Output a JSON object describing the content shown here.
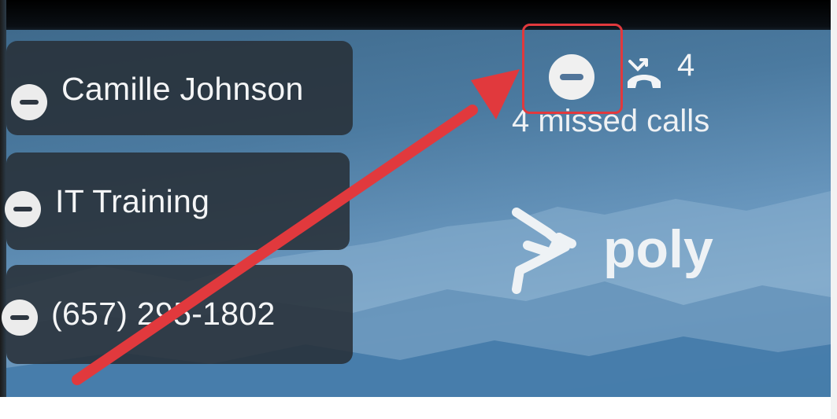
{
  "header": {
    "status_icon": "do-not-disturb-icon",
    "missed_calls_icon": "missed-call-icon",
    "missed_calls_count": "4",
    "missed_calls_text": "4 missed calls"
  },
  "contacts": [
    {
      "name": "Camille Johnson",
      "status_icon": "do-not-disturb-icon"
    },
    {
      "name": "IT Training",
      "status_icon": "do-not-disturb-icon"
    },
    {
      "name": "(657) 295-1802",
      "status_icon": "do-not-disturb-icon"
    }
  ],
  "branding": {
    "logo": "poly-logo"
  },
  "annotation": {
    "highlight_color": "#e1393d",
    "arrow_color": "#e1393d"
  },
  "colors": {
    "card_bg": "#283038",
    "wallpaper": "#5f8db4",
    "text": "#f4f5f6"
  }
}
